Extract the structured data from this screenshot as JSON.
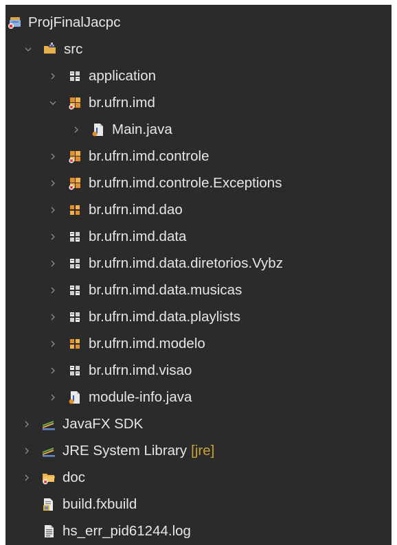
{
  "tree": {
    "project": {
      "label": "ProjFinalJacpc",
      "icon": "project-error-icon",
      "expanded": true
    },
    "src": {
      "label": "src",
      "icon": "source-folder-icon",
      "expanded": true
    },
    "packages": [
      {
        "label": "application",
        "icon": "package-icon",
        "expanded": false
      },
      {
        "label": "br.ufrn.imd",
        "icon": "package-error-icon",
        "expanded": true
      },
      {
        "label": "Main.java",
        "icon": "java-file-icon",
        "expanded": false
      },
      {
        "label": "br.ufrn.imd.controle",
        "icon": "package-error-icon",
        "expanded": false
      },
      {
        "label": "br.ufrn.imd.controle.Exceptions",
        "icon": "package-error-icon",
        "expanded": false
      },
      {
        "label": "br.ufrn.imd.dao",
        "icon": "package-warning-icon",
        "expanded": false
      },
      {
        "label": "br.ufrn.imd.data",
        "icon": "package-icon",
        "expanded": false
      },
      {
        "label": "br.ufrn.imd.data.diretorios.Vybz",
        "icon": "package-icon",
        "expanded": false
      },
      {
        "label": "br.ufrn.imd.data.musicas",
        "icon": "package-icon",
        "expanded": false
      },
      {
        "label": "br.ufrn.imd.data.playlists",
        "icon": "package-icon",
        "expanded": false
      },
      {
        "label": "br.ufrn.imd.modelo",
        "icon": "package-warning-icon",
        "expanded": false
      },
      {
        "label": "br.ufrn.imd.visao",
        "icon": "package-icon",
        "expanded": false
      },
      {
        "label": "module-info.java",
        "icon": "java-file-icon",
        "expanded": false
      }
    ],
    "libraries": [
      {
        "label": "JavaFX SDK",
        "icon": "library-icon"
      },
      {
        "label": "JRE System Library",
        "suffix": "[jre]",
        "icon": "library-icon"
      }
    ],
    "doc": {
      "label": "doc",
      "icon": "folder-error-icon"
    },
    "files": [
      {
        "label": "build.fxbuild",
        "icon": "fxbuild-file-icon"
      },
      {
        "label": "hs_err_pid61244.log",
        "icon": "text-file-icon"
      }
    ]
  },
  "colors": {
    "background": "#2b2b2b",
    "text": "#e6e6e6",
    "chevron": "#8a8a8a",
    "decoration_suffix": "#c9a23a",
    "package_warning": "#e0912b"
  }
}
